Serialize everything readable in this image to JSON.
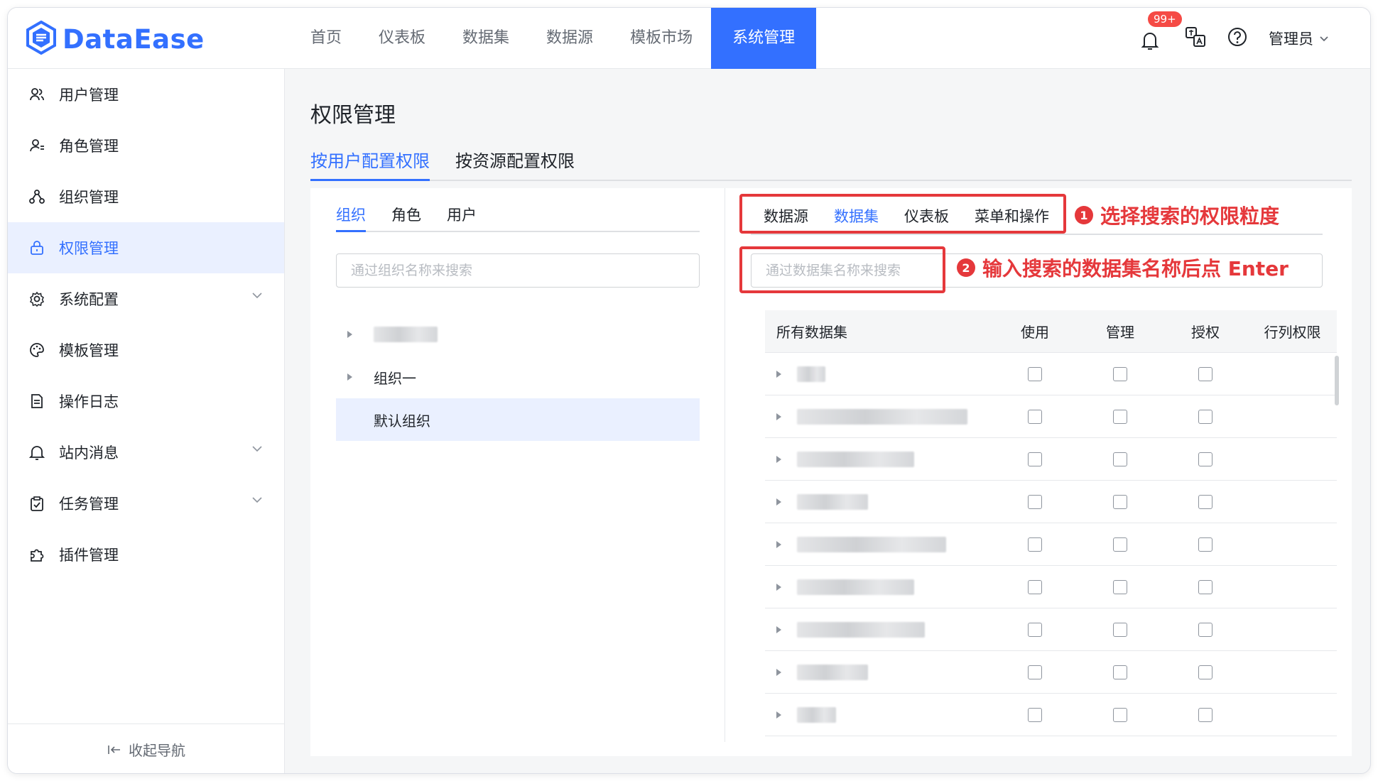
{
  "app": {
    "logo": "DataEase"
  },
  "nav": {
    "items": [
      "首页",
      "仪表板",
      "数据集",
      "数据源",
      "模板市场",
      "系统管理"
    ],
    "active": "系统管理"
  },
  "header": {
    "badge": "99+",
    "user": "管理员"
  },
  "sidebar": {
    "items": [
      {
        "label": "用户管理",
        "icon": "users-icon"
      },
      {
        "label": "角色管理",
        "icon": "role-icon"
      },
      {
        "label": "组织管理",
        "icon": "org-icon"
      },
      {
        "label": "权限管理",
        "icon": "lock-icon"
      },
      {
        "label": "系统配置",
        "icon": "gear-icon"
      },
      {
        "label": "模板管理",
        "icon": "palette-icon"
      },
      {
        "label": "操作日志",
        "icon": "document-icon"
      },
      {
        "label": "站内消息",
        "icon": "bell-icon"
      },
      {
        "label": "任务管理",
        "icon": "clipboard-icon"
      },
      {
        "label": "插件管理",
        "icon": "plugin-icon"
      }
    ],
    "collapse_label": "收起导航"
  },
  "page": {
    "title": "权限管理",
    "tabs": [
      "按用户配置权限",
      "按资源配置权限"
    ]
  },
  "left": {
    "tabs": [
      "组织",
      "角色",
      "用户"
    ],
    "search_placeholder": "通过组织名称来搜索",
    "tree": [
      {
        "label": "",
        "blurred": true
      },
      {
        "label": "组织一",
        "blurred": false
      },
      {
        "label": "默认组织",
        "blurred": false,
        "selected": true
      }
    ]
  },
  "right": {
    "type_tabs": [
      "数据源",
      "数据集",
      "仪表板",
      "菜单和操作"
    ],
    "active_type": "数据集",
    "search_placeholder": "通过数据集名称来搜索",
    "columns": [
      "所有数据集",
      "使用",
      "管理",
      "授权",
      "行列权限"
    ],
    "row_count": 9
  },
  "annotations": {
    "callout1": {
      "num": "1",
      "text": "选择搜索的权限粒度"
    },
    "callout2": {
      "num": "2",
      "text": "输入搜索的数据集名称后点 Enter"
    },
    "color": "#e5383b"
  },
  "colors": {
    "accent": "#3370ff",
    "active_bg": "#eaf0ff"
  }
}
